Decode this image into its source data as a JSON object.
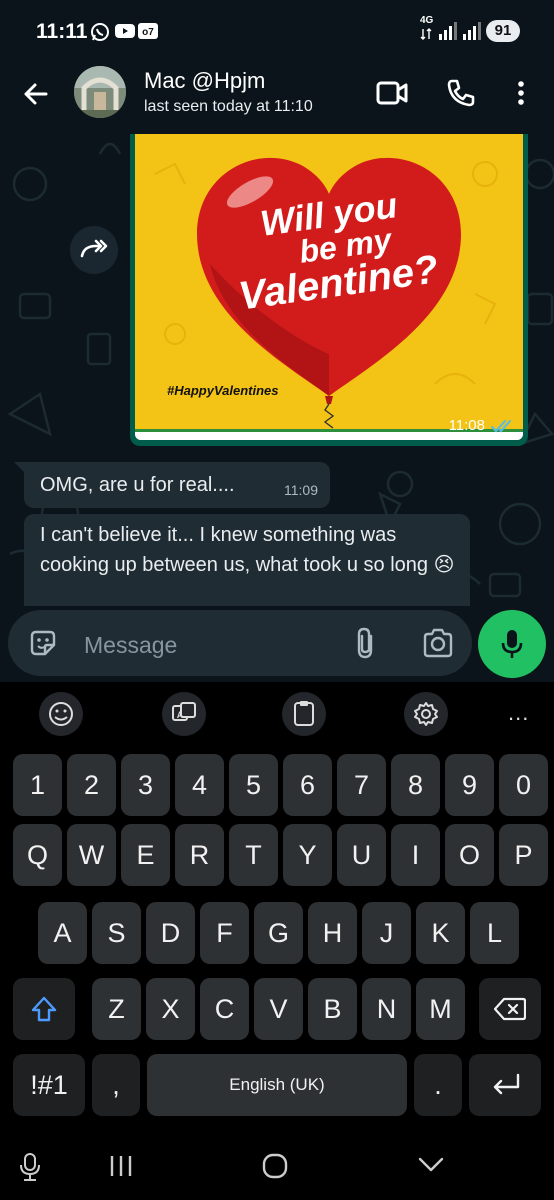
{
  "status_bar": {
    "time": "11:11",
    "network": "4G",
    "battery": "91"
  },
  "header": {
    "contact_name": "Mac @Hpjm",
    "contact_status": "last seen today at 11:10"
  },
  "messages": [
    {
      "type": "image",
      "direction": "outgoing",
      "image_text": "#HappyValentines",
      "time": "11:08",
      "status": "read"
    },
    {
      "type": "text",
      "direction": "incoming",
      "text": "OMG, are u for real....",
      "time": "11:09"
    },
    {
      "type": "text",
      "direction": "incoming",
      "text": "I can't believe it... I knew something was cooking up between us, what took u so long 😣"
    }
  ],
  "input": {
    "placeholder": "Message"
  },
  "keyboard": {
    "number_row": [
      "1",
      "2",
      "3",
      "4",
      "5",
      "6",
      "7",
      "8",
      "9",
      "0"
    ],
    "row1": [
      "Q",
      "W",
      "E",
      "R",
      "T",
      "Y",
      "U",
      "I",
      "O",
      "P"
    ],
    "row2": [
      "A",
      "S",
      "D",
      "F",
      "G",
      "H",
      "J",
      "K",
      "L"
    ],
    "row3": [
      "Z",
      "X",
      "C",
      "V",
      "B",
      "N",
      "M"
    ],
    "symbols_label": "!#1",
    "comma": ",",
    "space_label": "English (UK)",
    "period": ".",
    "toolbar_more": "..."
  },
  "colors": {
    "accent": "#21c063",
    "outgoing_bubble": "#005c4b",
    "incoming_bubble": "#202c33",
    "background": "#0b141a",
    "read_tick": "#53bdeb"
  }
}
